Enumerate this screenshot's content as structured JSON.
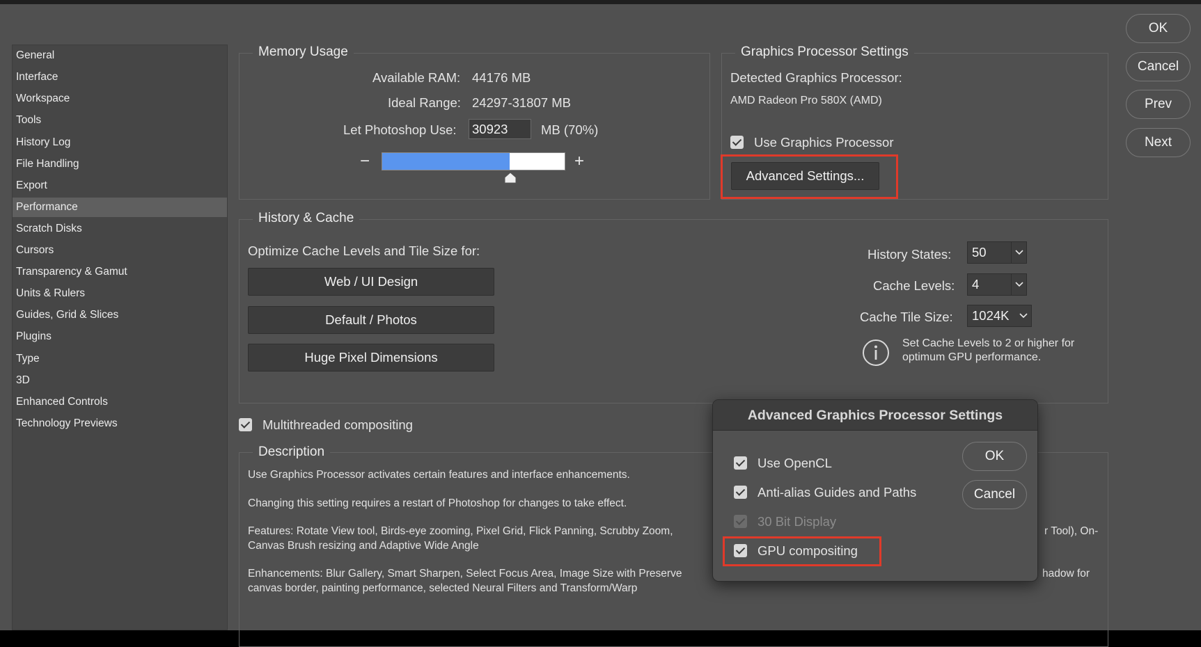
{
  "sidebar": {
    "items": [
      {
        "label": "General"
      },
      {
        "label": "Interface"
      },
      {
        "label": "Workspace"
      },
      {
        "label": "Tools"
      },
      {
        "label": "History Log"
      },
      {
        "label": "File Handling"
      },
      {
        "label": "Export"
      },
      {
        "label": "Performance",
        "selected": true
      },
      {
        "label": "Scratch Disks"
      },
      {
        "label": "Cursors"
      },
      {
        "label": "Transparency & Gamut"
      },
      {
        "label": "Units & Rulers"
      },
      {
        "label": "Guides, Grid & Slices"
      },
      {
        "label": "Plugins"
      },
      {
        "label": "Type"
      },
      {
        "label": "3D"
      },
      {
        "label": "Enhanced Controls"
      },
      {
        "label": "Technology Previews"
      }
    ]
  },
  "buttons": {
    "ok": "OK",
    "cancel": "Cancel",
    "prev": "Prev",
    "next": "Next"
  },
  "memory": {
    "title": "Memory Usage",
    "available_label": "Available RAM:",
    "available_value": "44176 MB",
    "ideal_label": "Ideal Range:",
    "ideal_value": "24297-31807 MB",
    "use_label": "Let Photoshop Use:",
    "use_value": "30923",
    "use_unit": "MB (70%)",
    "slider_fraction": 0.7,
    "minus": "−",
    "plus": "+"
  },
  "gpu": {
    "title": "Graphics Processor Settings",
    "detected_label": "Detected Graphics Processor:",
    "detected_value": "AMD Radeon Pro 580X (AMD)",
    "use_gpu_label": "Use Graphics Processor",
    "use_gpu_checked": true,
    "advanced_button": "Advanced Settings..."
  },
  "history_cache": {
    "title": "History & Cache",
    "optimize_label": "Optimize Cache Levels and Tile Size for:",
    "presets": [
      "Web / UI Design",
      "Default / Photos",
      "Huge Pixel Dimensions"
    ],
    "history_states_label": "History States:",
    "history_states_value": "50",
    "cache_levels_label": "Cache Levels:",
    "cache_levels_value": "4",
    "tile_size_label": "Cache Tile Size:",
    "tile_size_value": "1024K",
    "info_line1": "Set Cache Levels to 2 or higher for",
    "info_line2": "optimum GPU performance."
  },
  "multithreaded": {
    "label": "Multithreaded compositing",
    "checked": true
  },
  "description": {
    "title": "Description",
    "p1": "Use Graphics Processor activates certain features and interface enhancements.",
    "p2": "Changing this setting requires a restart of Photoshop for changes to take effect.",
    "p3a": "Features: Rotate View tool, Birds-eye zooming, Pixel Grid, Flick Panning, Scrubby Zoom,",
    "p3a_tail": "r Tool), On-",
    "p3b": "Canvas Brush resizing and Adaptive Wide Angle",
    "p4a": "Enhancements: Blur Gallery, Smart Sharpen, Select Focus Area, Image Size with Preserve",
    "p4a_tail": "hadow for",
    "p4b": "canvas border, painting performance, selected Neural Filters and Transform/Warp"
  },
  "advanced_dialog": {
    "title": "Advanced Graphics Processor Settings",
    "options": [
      {
        "label": "Use OpenCL",
        "checked": true,
        "enabled": true
      },
      {
        "label": "Anti-alias Guides and Paths",
        "checked": true,
        "enabled": true
      },
      {
        "label": "30 Bit Display",
        "checked": true,
        "enabled": false
      },
      {
        "label": "GPU compositing",
        "checked": true,
        "enabled": true
      }
    ],
    "ok": "OK",
    "cancel": "Cancel"
  },
  "colors": {
    "background": "#505050",
    "highlight_box": "#e03a2a",
    "slider_fill": "#5a95ee"
  }
}
